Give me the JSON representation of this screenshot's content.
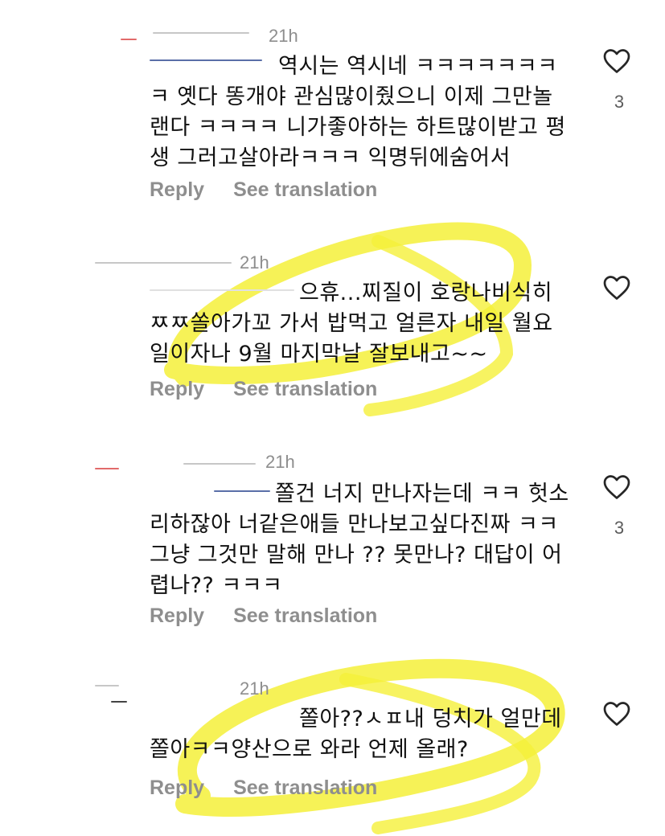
{
  "comments": [
    {
      "time": "21h",
      "text": "역시는 역시네 ㅋㅋㅋㅋㅋㅋㅋ\nㅋ 옛다 똥개야 관심많이줬으니 이제 그만놀\n랜다 ㅋㅋㅋㅋ 니가좋아하는 하트많이받고 평\n생 그러고살아라ㅋㅋㅋ 익명뒤에숨어서",
      "likes": "3",
      "reply_label": "Reply",
      "translate_label": "See translation"
    },
    {
      "time": "21h",
      "text": "으휴...찌질이 호랑나비식히\nㅉㅉ쏠아가꼬 가서 밥먹고 얼른자 내일 월요\n일이자나 9월 마지막날 잘보내고~~",
      "likes": "",
      "reply_label": "Reply",
      "translate_label": "See translation"
    },
    {
      "time": "21h",
      "text": "쫄건 너지 만나자는데 ㅋㅋ 헛소\n리하잖아 너같은애들 만나보고싶다진짜 ㅋㅋ\n그냥 그것만 말해 만나 ?? 못만나? 대답이 어\n렵나?? ㅋㅋㅋ",
      "likes": "3",
      "reply_label": "Reply",
      "translate_label": "See translation"
    },
    {
      "time": "21h",
      "text": "쫄아??ㅅㅍ내 덩치가 얼만데\n쫄아ㅋㅋ양산으로 와라 언제 올래?",
      "likes": "",
      "reply_label": "Reply",
      "translate_label": "See translation"
    }
  ],
  "colors": {
    "highlight": "#f5f03a",
    "meta_text": "#8e8e8e",
    "body_text": "#111111"
  },
  "icons": {
    "like": "heart-outline-icon"
  }
}
